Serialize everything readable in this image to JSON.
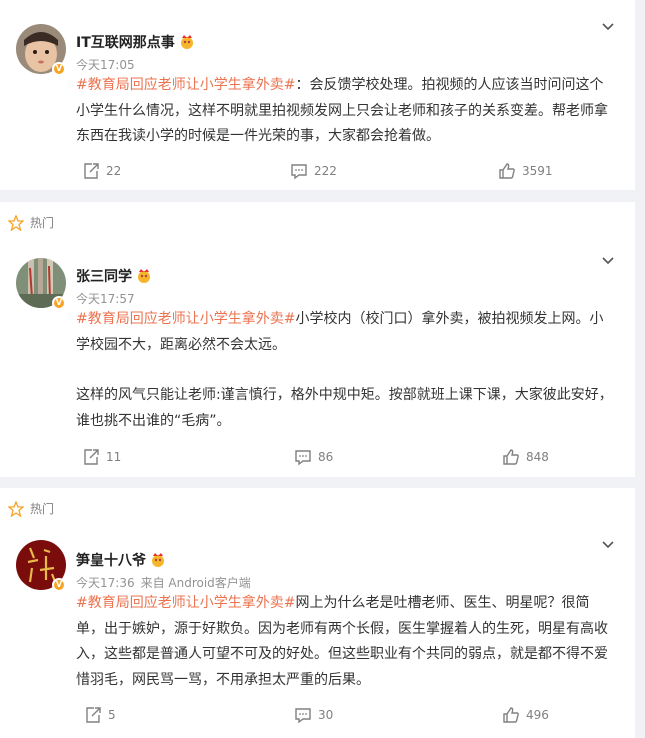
{
  "posts": [
    {
      "hot_label": "",
      "username": "IT互联网那点事",
      "time": "今天17:05",
      "source": "",
      "hashtag": "#教育局回应老师让小学生拿外卖#",
      "paragraphs": [
        "：会反馈学校处理。拍视频的人应该当时问问这个小学生什么情况，这样不明就里拍视频发网上只会让老师和孩子的关系变差。帮老师拿东西在我读小学的时候是一件光荣的事，大家都会抢着做。"
      ],
      "repost_count": "22",
      "comment_count": "222",
      "like_count": "3591"
    },
    {
      "hot_label": "热门",
      "username": "张三同学",
      "time": "今天17:57",
      "source": "",
      "hashtag": "#教育局回应老师让小学生拿外卖#",
      "paragraphs": [
        "小学校内（校门口）拿外卖，被拍视频发上网。小学校园不大，距离必然不会太远。",
        "这样的风气只能让老师:谨言慎行，格外中规中矩。按部就班上课下课，大家彼此安好，谁也挑不出谁的“毛病”。"
      ],
      "repost_count": "11",
      "comment_count": "86",
      "like_count": "848"
    },
    {
      "hot_label": "热门",
      "username": "笋皇十八爷",
      "time": "今天17:36",
      "source": "来自 Android客户端",
      "hashtag": "#教育局回应老师让小学生拿外卖#",
      "paragraphs": [
        "网上为什么老是吐槽老师、医生、明星呢？很简单，出于嫉妒，源于好欺负。因为老师有两个长假，医生掌握着人的生死，明星有高收入，这些都是普通人可望不可及的好处。但这些职业有个共同的弱点，就是都不得不爱惜羽毛，网民骂一骂，不用承担太严重的后果。"
      ],
      "repost_count": "5",
      "comment_count": "30",
      "like_count": "496"
    }
  ],
  "colors": {
    "hashtag": "#eb7350",
    "badge": "#f7a325",
    "meta": "#939393",
    "page_bg": "#f1f2f5"
  },
  "icons": [
    "chevron-down-icon",
    "repost-icon",
    "comment-icon",
    "like-icon",
    "star-icon",
    "crown-icon",
    "verified-v-icon"
  ]
}
